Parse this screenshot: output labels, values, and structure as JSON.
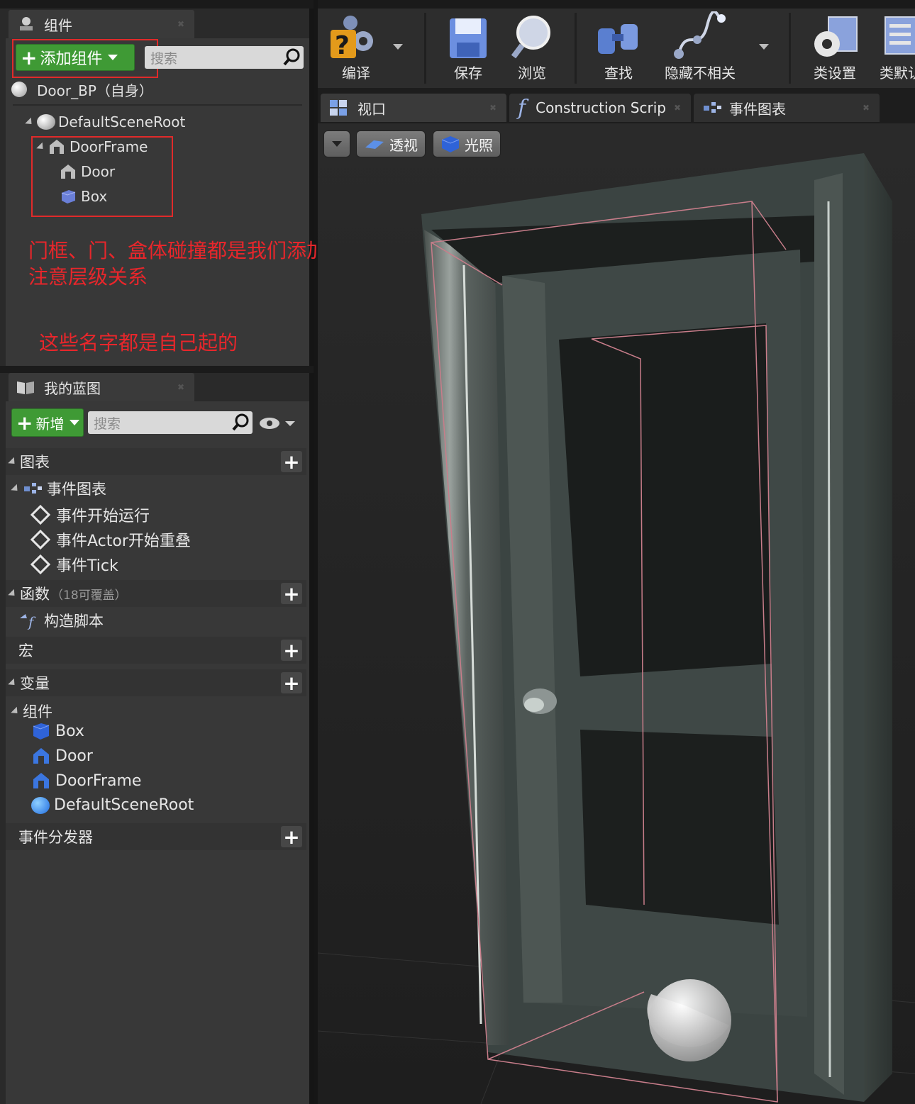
{
  "components_panel": {
    "tab_label": "组件",
    "add_button_label": "添加组件",
    "search_placeholder": "搜索",
    "self_item": "Door_BP（自身）",
    "tree": [
      "DefaultSceneRoot",
      "DoorFrame",
      "Door",
      "Box"
    ]
  },
  "annotations": {
    "line1": "门框、门、盒体碰撞都是我们添加进来的",
    "line2": "注意层级关系",
    "line3": "这些名字都是自己起的"
  },
  "blueprint_panel": {
    "tab_label": "我的蓝图",
    "new_button_label": "新增",
    "search_placeholder": "搜索",
    "sections": {
      "graphs": "图表",
      "event_graph": "事件图表",
      "events": [
        "事件开始运行",
        "事件Actor开始重叠",
        "事件Tick"
      ],
      "functions": "函数",
      "functions_note": "（18可覆盖）",
      "construction_script": "构造脚本",
      "macros": "宏",
      "variables": "变量",
      "components": "组件",
      "component_items": [
        "Box",
        "Door",
        "DoorFrame",
        "DefaultSceneRoot"
      ],
      "dispatchers": "事件分发器"
    }
  },
  "toolbar": {
    "compile": "编译",
    "save": "保存",
    "browse": "浏览",
    "find": "查找",
    "hide_unrelated": "隐藏不相关",
    "class_settings": "类设置",
    "class_defaults": "类默认"
  },
  "doc_tabs": [
    "视口",
    "Construction Scrip",
    "事件图表"
  ],
  "viewport": {
    "perspective": "透视",
    "lit": "光照"
  }
}
